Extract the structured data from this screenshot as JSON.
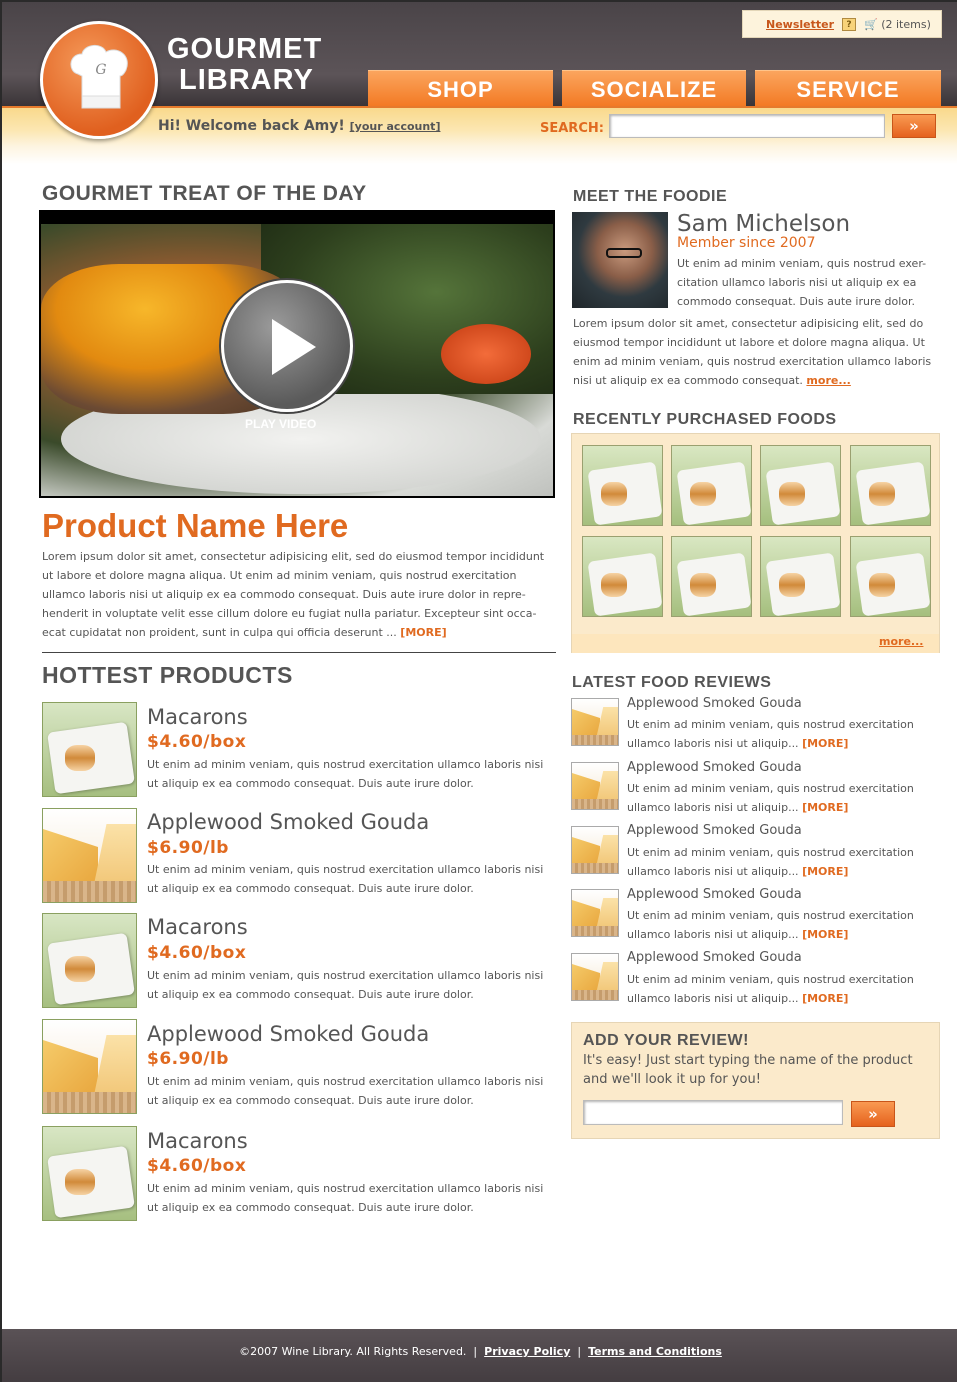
{
  "brand": {
    "line1": "GOURMET",
    "line2": "LIBRARY"
  },
  "topbar": {
    "newsletter": "Newsletter",
    "help": "?",
    "cart": "(2 items)"
  },
  "nav": [
    {
      "label": "SHOP"
    },
    {
      "label": "SOCIALIZE"
    },
    {
      "label": "SERVICE"
    }
  ],
  "welcome": {
    "greeting": "Hi! Welcome back Amy!",
    "account": "[your account]"
  },
  "search": {
    "label": "SEARCH:",
    "value": "",
    "go": "»"
  },
  "treat": {
    "heading": "GOURMET TREAT OF THE DAY",
    "play_label": "PLAY VIDEO",
    "product_name": "Product Name Here",
    "description": "Lorem ipsum dolor sit amet, consectetur adipisicing elit, sed do eiusmod tempor incididunt ut labore et dolore magna aliqua. Ut enim ad minim veniam, quis nostrud exercitation ullamco laboris nisi ut aliquip ex ea commodo consequat. Duis aute irure dolor in repre-henderit in voluptate velit esse cillum dolore eu fugiat nulla pariatur. Excepteur sint occa-ecat cupidatat non proident, sunt in culpa qui officia deserunt ...",
    "more": "[MORE]"
  },
  "hottest": {
    "heading": "HOTTEST PRODUCTS",
    "items": [
      {
        "name": "Macarons",
        "price": "$4.60/box",
        "desc": "Ut enim ad minim veniam, quis nostrud exercitation ullamco laboris nisi ut aliquip ex ea commodo consequat. Duis aute irure dolor.",
        "img": "macarons-image"
      },
      {
        "name": "Applewood Smoked Gouda",
        "price": "$6.90/lb",
        "desc": "Ut enim ad minim veniam, quis nostrud exercitation ullamco laboris nisi ut aliquip ex ea commodo consequat. Duis aute irure dolor.",
        "img": "gouda-image"
      },
      {
        "name": "Macarons",
        "price": "$4.60/box",
        "desc": "Ut enim ad minim veniam, quis nostrud exercitation ullamco laboris nisi ut aliquip ex ea commodo consequat. Duis aute irure dolor.",
        "img": "macarons-image"
      },
      {
        "name": "Applewood Smoked Gouda",
        "price": "$6.90/lb",
        "desc": "Ut enim ad minim veniam, quis nostrud exercitation ullamco laboris nisi ut aliquip ex ea commodo consequat. Duis aute irure dolor.",
        "img": "gouda-image"
      },
      {
        "name": "Macarons",
        "price": "$4.60/box",
        "desc": "Ut enim ad minim veniam, quis nostrud exercitation ullamco laboris nisi ut aliquip ex ea commodo consequat. Duis aute irure dolor.",
        "img": "macarons-image"
      }
    ]
  },
  "foodie": {
    "heading": "MEET THE FOODIE",
    "name": "Sam Michelson",
    "since": "Member since 2007",
    "intro": "Ut enim ad minim veniam, quis nostrud exer-citation ullamco laboris nisi ut aliquip ex ea commodo consequat. Duis aute irure dolor.",
    "bio": "Lorem ipsum dolor sit amet, consectetur adipisicing elit, sed do eiusmod tempor incididunt ut labore et dolore magna aliqua. Ut enim ad minim veniam, quis nostrud exercitation ullamco laboris nisi ut aliquip ex ea commodo consequat.",
    "more": "more..."
  },
  "recent": {
    "heading": "RECENTLY PURCHASED FOODS",
    "more": "more...",
    "count": 8
  },
  "reviews": {
    "heading": "LATEST FOOD REVIEWS",
    "items": [
      {
        "title": "Applewood Smoked Gouda",
        "text": "Ut enim ad minim veniam, quis nostrud exercitation ullamco laboris nisi ut aliquip...",
        "more": "[MORE]"
      },
      {
        "title": "Applewood Smoked Gouda",
        "text": "Ut enim ad minim veniam, quis nostrud exercitation ullamco laboris nisi ut aliquip...",
        "more": "[MORE]"
      },
      {
        "title": "Applewood Smoked Gouda",
        "text": "Ut enim ad minim veniam, quis nostrud exercitation ullamco laboris nisi ut aliquip...",
        "more": "[MORE]"
      },
      {
        "title": "Applewood Smoked Gouda",
        "text": "Ut enim ad minim veniam, quis nostrud exercitation ullamco laboris nisi ut aliquip...",
        "more": "[MORE]"
      },
      {
        "title": "Applewood Smoked Gouda",
        "text": "Ut enim ad minim veniam, quis nostrud exercitation ullamco laboris nisi ut aliquip...",
        "more": "[MORE]"
      }
    ]
  },
  "add_review": {
    "heading": "ADD YOUR REVIEW!",
    "text": "It's easy! Just start typing the name of the product and we'll look it up for you!",
    "value": "",
    "go": "»"
  },
  "footer": {
    "copyright": "©2007 Wine Library. All Rights Reserved.",
    "sep": "|",
    "privacy": "Privacy Policy",
    "terms": "Terms and Conditions"
  },
  "colors": {
    "accent": "#e06a20",
    "header": "#4f484c",
    "toolbar": "#fce7b3",
    "panel": "#fbeacb"
  }
}
